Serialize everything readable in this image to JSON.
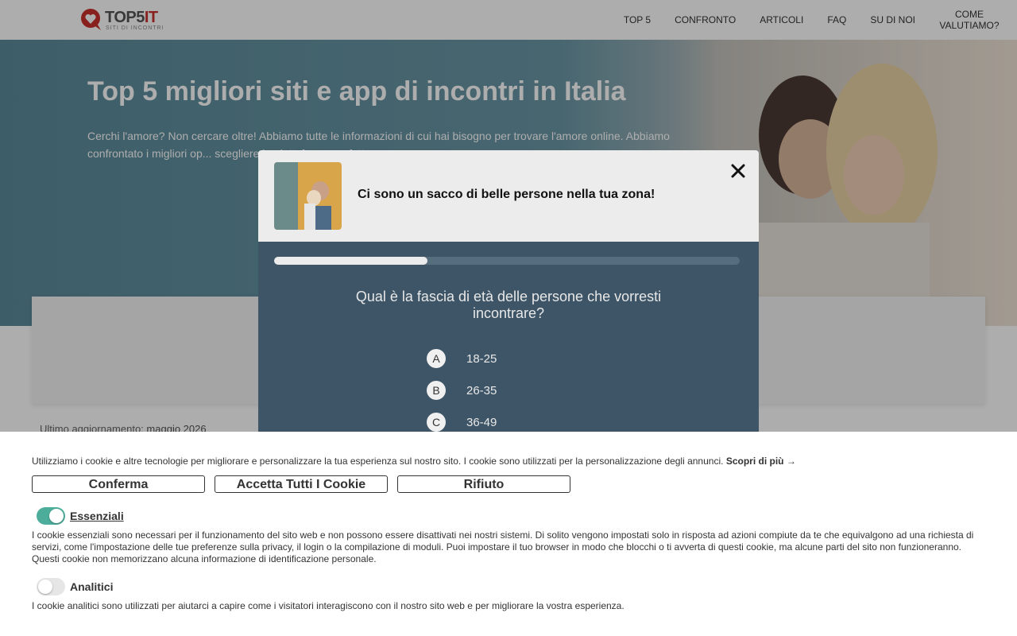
{
  "header": {
    "logo": {
      "name": "TOP5IT",
      "brand_main": "TOP5",
      "brand_suffix": "IT",
      "tagline": "SITI DI INCONTRI"
    },
    "nav": [
      {
        "label": "TOP 5"
      },
      {
        "label": "CONFRONTO"
      },
      {
        "label": "ARTICOLI"
      },
      {
        "label": "FAQ"
      },
      {
        "label": "SU DI NOI"
      },
      {
        "label": "COME VALUTIAMO?"
      }
    ]
  },
  "hero": {
    "title": "Top 5 migliori siti e app di incontri in Italia",
    "text": "Cerchi l'amore? Non cercare oltre! Abbiamo tutte le informazioni di cui hai bisogno per trovare l'amore online. Abbiamo confrontato i migliori op... scegliere la piattaforma perfetta..."
  },
  "updated": {
    "label": "Ultimo aggiornamento:",
    "date": "maggio 2026"
  },
  "modal": {
    "heading": "Ci sono un sacco di belle persone nella tua zona!",
    "progress": 0.33,
    "question": "Qual è la fascia di età delle persone che vorresti incontrare?",
    "options": [
      {
        "letter": "A",
        "label": "18-25"
      },
      {
        "letter": "B",
        "label": "26-35"
      },
      {
        "letter": "C",
        "label": "36-49"
      }
    ]
  },
  "cookie": {
    "intro": "Utilizziamo i cookie e altre tecnologie per migliorare e personalizzare la tua esperienza sul nostro sito. I cookie sono utilizzati per la personalizzazione degli annunci.",
    "learn_more": "Scopri di più →",
    "buttons": {
      "confirm": "Conferma",
      "accept_all": "Accetta Tutti I Cookie",
      "reject": "Rifiuto"
    },
    "categories": [
      {
        "label": "Essenziali",
        "enabled": true,
        "description": "I cookie essenziali sono necessari per il funzionamento del sito web e non possono essere disattivati nei nostri sistemi. Di solito vengono impostati solo in risposta ad azioni compiute da te che equivalgono ad una richiesta di servizi, come l'impostazione delle tue preferenze sulla privacy, il login o la compilazione di moduli. Puoi impostare il tuo browser in modo che blocchi o ti avverta di questi cookie, ma alcune parti del sito non funzioneranno. Questi cookie non memorizzano alcuna informazione di identificazione personale."
      },
      {
        "label": "Analitici",
        "enabled": false,
        "description": "I cookie analitici sono utilizzati per aiutarci a capire come i visitatori interagiscono con il nostro sito web e per migliorare la vostra esperienza."
      }
    ]
  },
  "colors": {
    "brand": "#c9302c",
    "modal_bg": "#3d5566",
    "toggle_on": "#4cae9a"
  }
}
